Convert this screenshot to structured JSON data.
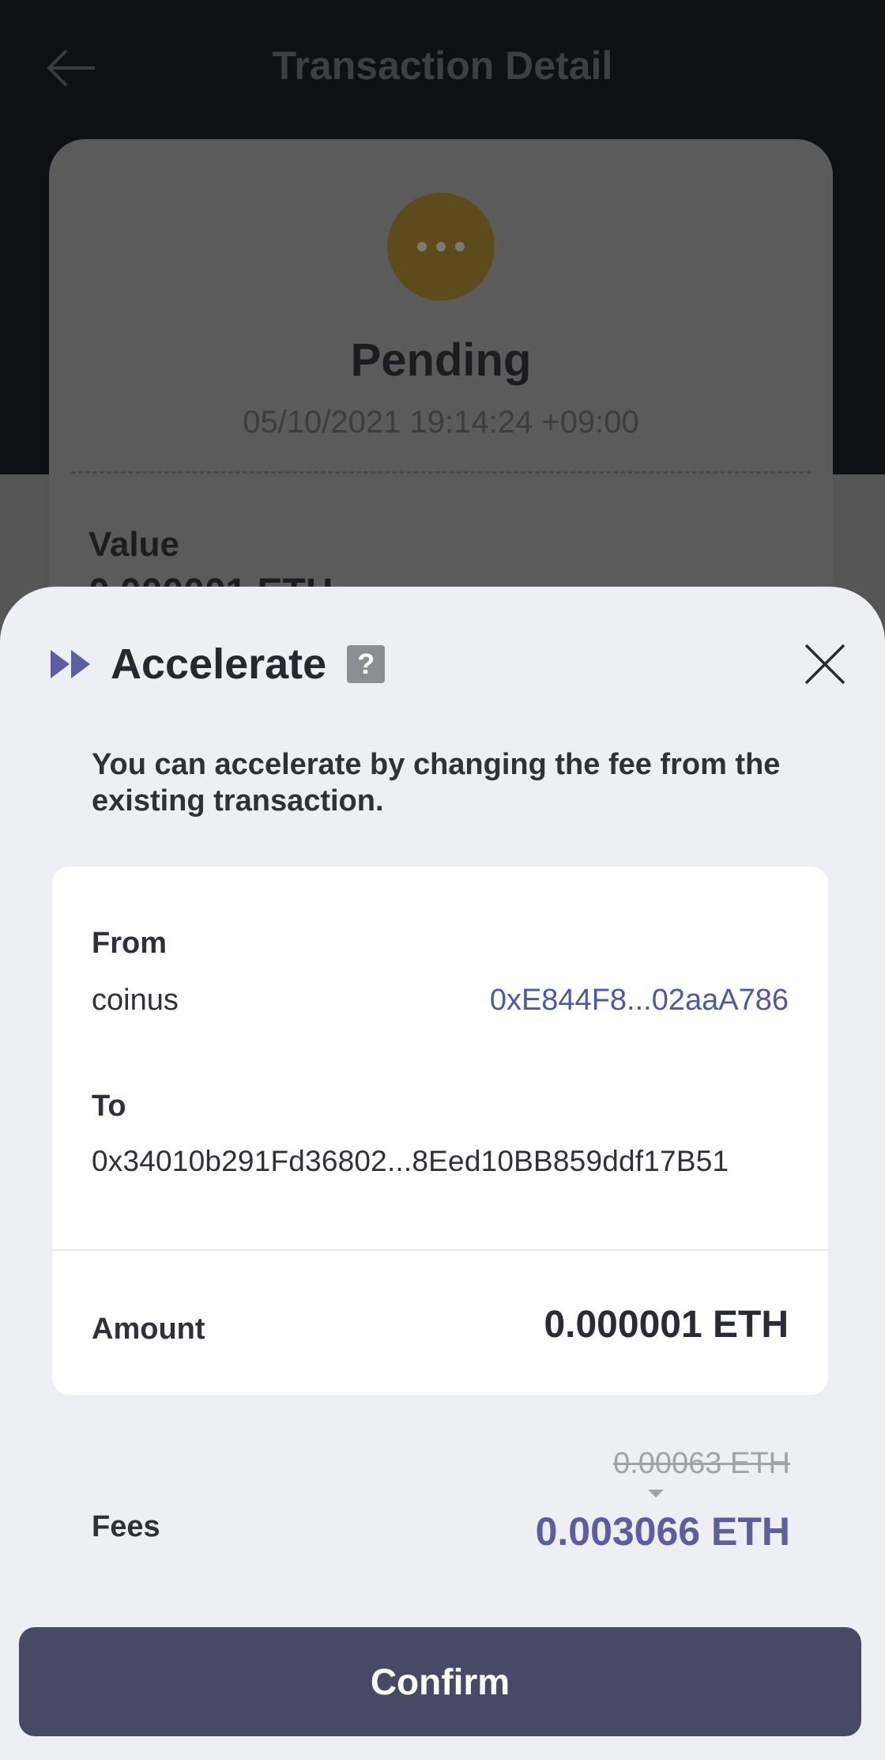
{
  "background": {
    "title": "Transaction Detail",
    "status": "Pending",
    "date": "05/10/2021 19:14:24 +09:00",
    "value_label": "Value",
    "value_partial": "0.000001 ETH"
  },
  "sheet": {
    "title": "Accelerate",
    "help_glyph": "?",
    "description": "You can accelerate by changing the fee from the existing transaction.",
    "from_label": "From",
    "from_name": "coinus",
    "from_address": "0xE844F8...02aaA786",
    "to_label": "To",
    "to_address": "0x34010b291Fd36802...8Eed10BB859ddf17B51",
    "amount_label": "Amount",
    "amount_value": "0.000001 ETH",
    "fees_label": "Fees",
    "fee_old": "0.00063 ETH",
    "fee_new": "0.003066 ETH",
    "confirm_label": "Confirm"
  },
  "colors": {
    "accent": "#5c5ea0",
    "address_link": "#4d5aa0",
    "button": "#474a65",
    "sheet_bg": "#eeeff4"
  },
  "icons": [
    "back-arrow-icon",
    "clock-dots-icon",
    "fast-forward-icon",
    "help-icon",
    "close-icon",
    "caret-down-icon"
  ]
}
